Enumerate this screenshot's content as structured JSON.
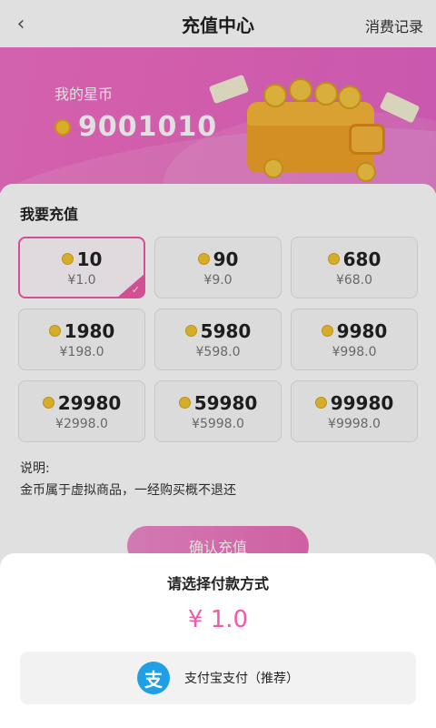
{
  "header": {
    "back_icon": "‹",
    "title": "充值中心",
    "history_label": "消费记录"
  },
  "banner": {
    "balance_label": "我的星币",
    "balance_value": "9001010"
  },
  "recharge": {
    "section_title": "我要充值",
    "packages": [
      {
        "coins": "10",
        "price": "¥1.0",
        "selected": true
      },
      {
        "coins": "90",
        "price": "¥9.0",
        "selected": false
      },
      {
        "coins": "680",
        "price": "¥68.0",
        "selected": false
      },
      {
        "coins": "1980",
        "price": "¥198.0",
        "selected": false
      },
      {
        "coins": "5980",
        "price": "¥598.0",
        "selected": false
      },
      {
        "coins": "9980",
        "price": "¥998.0",
        "selected": false
      },
      {
        "coins": "29980",
        "price": "¥2998.0",
        "selected": false
      },
      {
        "coins": "59980",
        "price": "¥5998.0",
        "selected": false
      },
      {
        "coins": "99980",
        "price": "¥9998.0",
        "selected": false
      }
    ],
    "note_label": "说明:",
    "note_text": "金币属于虚拟商品，一经购买概不退还",
    "confirm_label": "确认充值"
  },
  "payment_sheet": {
    "title": "请选择付款方式",
    "amount": "¥ 1.0",
    "option_icon_glyph": "支",
    "option_label": "支付宝支付（推荐）"
  },
  "colors": {
    "accent_pink": "#ee5ba8",
    "banner_pink": "#f070c6",
    "alipay_blue": "#1fa0e6",
    "coin_gold": "#f4c531"
  }
}
